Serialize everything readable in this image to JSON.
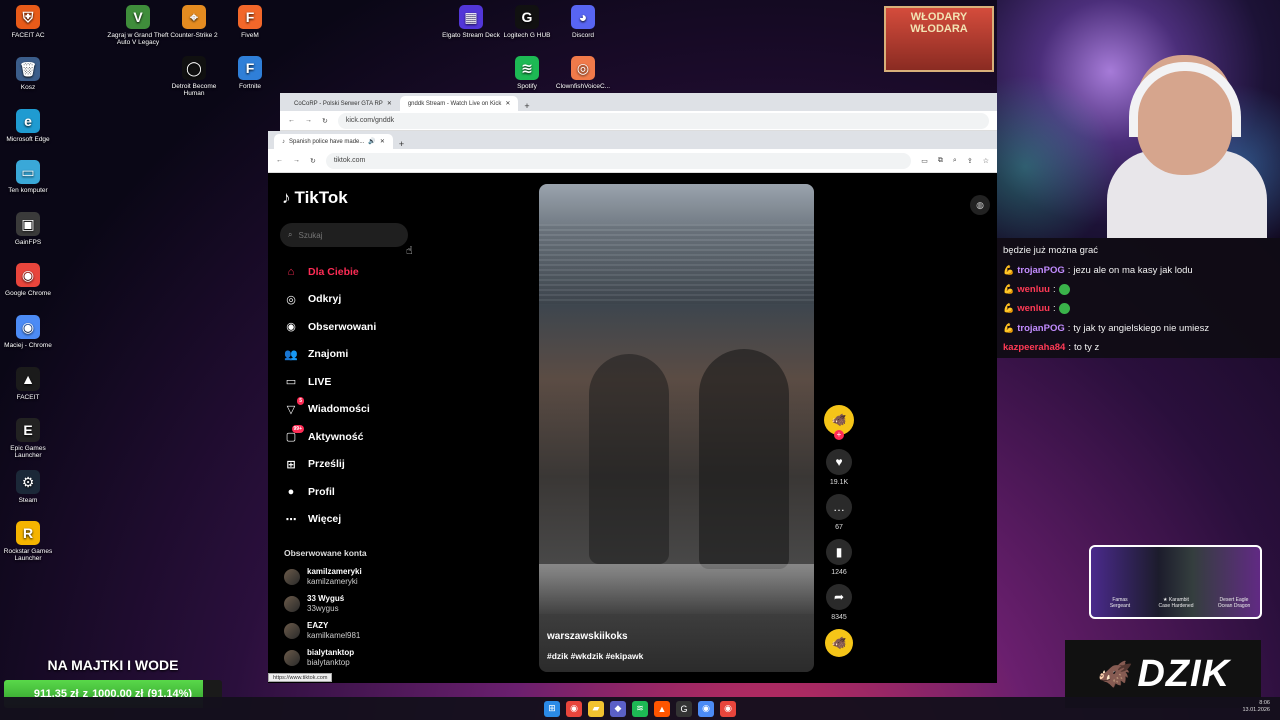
{
  "desktop": {
    "icons_left": [
      {
        "label": "FACEIT AC",
        "glyph": "⛨",
        "color": "#e85b19"
      },
      {
        "label": "Kosz",
        "glyph": "🗑",
        "color": "#3b5d8a"
      },
      {
        "label": "Microsoft Edge",
        "glyph": "e",
        "color": "#1f9bd1"
      },
      {
        "label": "Ten komputer",
        "glyph": "▭",
        "color": "#3aa8d8"
      },
      {
        "label": "GainFPS",
        "glyph": "▣",
        "color": "#3a3a3a"
      },
      {
        "label": "Google Chrome",
        "glyph": "◉",
        "color": "#e8453c"
      },
      {
        "label": "Maciej - Chrome",
        "glyph": "◉",
        "color": "#4c8bf5"
      },
      {
        "label": "FACEIT",
        "glyph": "▲",
        "color": "#1b1b1b"
      },
      {
        "label": "Epic Games Launcher",
        "glyph": "E",
        "color": "#222222"
      },
      {
        "label": "Steam",
        "glyph": "⚙",
        "color": "#1b2838"
      },
      {
        "label": "Rockstar Games Launcher",
        "glyph": "R",
        "color": "#f5b400"
      }
    ],
    "icons_top": [
      {
        "label": "Zagraj w Grand Theft Auto V Legacy",
        "glyph": "V",
        "color": "#3f8d3b"
      },
      {
        "label": "Counter-Strike 2",
        "glyph": "⌖",
        "color": "#e48b20"
      },
      {
        "label": "FiveM",
        "glyph": "F",
        "color": "#f2672a"
      },
      {
        "label": "Detroit Become Human",
        "glyph": "◯",
        "color": "#101010"
      },
      {
        "label": "Fortnite",
        "glyph": "F",
        "color": "#2f7fd8"
      },
      {
        "label": "Elgato Stream Deck",
        "glyph": "▦",
        "color": "#5236d8"
      },
      {
        "label": "Logitech G HUB",
        "glyph": "G",
        "color": "#111111"
      },
      {
        "label": "Discord",
        "glyph": "◕",
        "color": "#5865f2"
      },
      {
        "label": "Spotify",
        "glyph": "≋",
        "color": "#1db954"
      },
      {
        "label": "ClownfishVoiceC...",
        "glyph": "◎",
        "color": "#f07a4a"
      }
    ]
  },
  "browser_back": {
    "tabs": [
      "CoCoRP - Polski Serwer GTA RP",
      "gnddk Stream - Watch Live on Kick"
    ],
    "url": "kick.com/gnddk"
  },
  "browser": {
    "tab_title": "Spanish police have made...",
    "url": "tiktok.com",
    "status_url": "https://www.tiktok.com"
  },
  "tiktok": {
    "logo": "TikTok",
    "search_placeholder": "Szukaj",
    "nav": [
      {
        "label": "Dla Ciebie",
        "icon": "home-icon",
        "glyph": "⌂",
        "active": true
      },
      {
        "label": "Odkryj",
        "icon": "compass-icon",
        "glyph": "◎"
      },
      {
        "label": "Obserwowani",
        "icon": "following-icon",
        "glyph": "◉"
      },
      {
        "label": "Znajomi",
        "icon": "friends-icon",
        "glyph": "👥"
      },
      {
        "label": "LIVE",
        "icon": "live-icon",
        "glyph": "▭"
      },
      {
        "label": "Wiadomości",
        "icon": "messages-icon",
        "glyph": "▽",
        "badge": "5"
      },
      {
        "label": "Aktywność",
        "icon": "activity-icon",
        "glyph": "▢",
        "badge": "99+"
      },
      {
        "label": "Prześlij",
        "icon": "upload-icon",
        "glyph": "⊞"
      },
      {
        "label": "Profil",
        "icon": "profile-icon",
        "glyph": "●"
      },
      {
        "label": "Więcej",
        "icon": "more-icon",
        "glyph": "⋯"
      }
    ],
    "following_header": "Obserwowane konta",
    "following": [
      {
        "name": "kamilzameryki",
        "handle": "kamilzameryki"
      },
      {
        "name": "33 Wyguś",
        "handle": "33wygus"
      },
      {
        "name": "EAZY",
        "handle": "kamilkamel981"
      },
      {
        "name": "bialytanktop",
        "handle": "bialytanktop"
      }
    ],
    "video": {
      "author": "warszawskiikoks",
      "tags": "#dzik #wkdzik #ekipawk",
      "likes": "19.1K",
      "comments": "67",
      "saves": "1246",
      "shares": "8345"
    }
  },
  "chat": [
    {
      "user": "",
      "color": "#ffffff",
      "text": "będzie już można grać",
      "arm": false
    },
    {
      "user": "trojanPOG",
      "color": "#c28cff",
      "text": "jezu ale on ma kasy jak lodu",
      "arm": true
    },
    {
      "user": "wenluu",
      "color": "#ff3a55",
      "text": "",
      "arm": true,
      "emote": true
    },
    {
      "user": "wenluu",
      "color": "#ff3a55",
      "text": "",
      "arm": true,
      "emote": true
    },
    {
      "user": "trojanPOG",
      "color": "#c28cff",
      "text": "ty jak ty angielskiego nie umiesz",
      "arm": true
    },
    {
      "user": "kazpeeraha84",
      "color": "#ff3a55",
      "text": "to ty z",
      "arm": false
    }
  ],
  "overlay": {
    "banner": "WŁODARY WŁODARA",
    "weapons": [
      {
        "name": "Famas",
        "skin": "Sergeant"
      },
      {
        "name": "★ Karambit",
        "skin": "Case Hardened"
      },
      {
        "name": "Desert Eagle",
        "skin": "Ocean Dragon"
      }
    ],
    "brand": "DZIK",
    "goal_title": "NA MAJTKI I WODE",
    "goal_current": "911,35 zł",
    "goal_sep": "z",
    "goal_target": "1000,00 zł",
    "goal_percent": "(91,14%)",
    "goal_fraction": 0.9114
  },
  "taskbar": {
    "time": "8:06",
    "date": "13.01.2026",
    "apps": [
      {
        "name": "start-icon",
        "glyph": "⊞",
        "color": "#2b8ae6"
      },
      {
        "name": "chrome-icon",
        "glyph": "◉",
        "color": "#e8453c"
      },
      {
        "name": "explorer-icon",
        "glyph": "▰",
        "color": "#f2c230"
      },
      {
        "name": "teams-icon",
        "glyph": "◆",
        "color": "#5b5fc7"
      },
      {
        "name": "spotify-icon",
        "glyph": "≋",
        "color": "#1db954"
      },
      {
        "name": "faceit-icon",
        "glyph": "▲",
        "color": "#ff5500"
      },
      {
        "name": "logitech-icon",
        "glyph": "G",
        "color": "#333333"
      },
      {
        "name": "chrome2-icon",
        "glyph": "◉",
        "color": "#4c8bf5"
      },
      {
        "name": "chrome3-icon",
        "glyph": "◉",
        "color": "#e8453c"
      }
    ]
  }
}
